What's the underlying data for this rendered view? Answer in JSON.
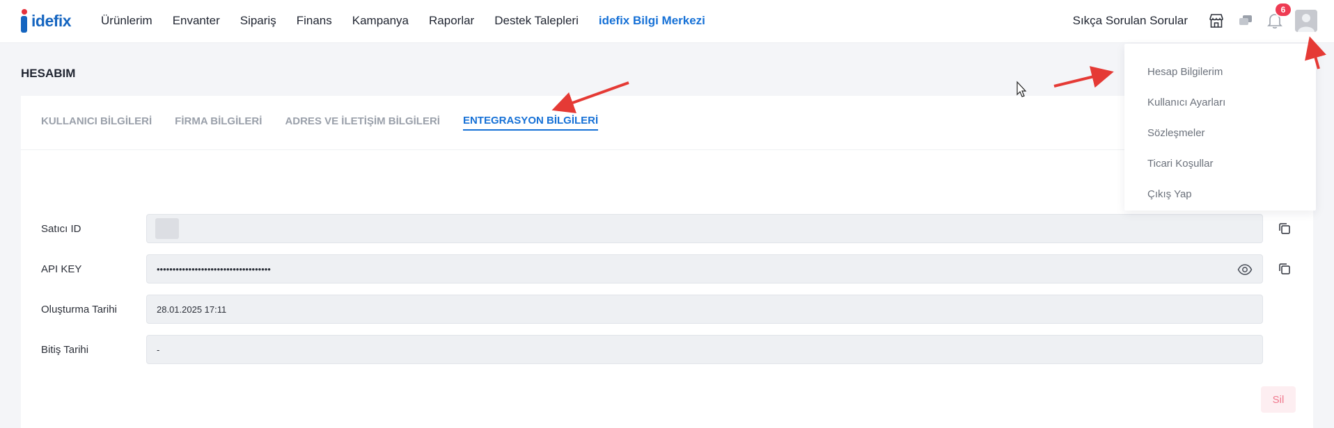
{
  "brand": {
    "logo_text": "idefix"
  },
  "nav": {
    "items": [
      "Ürünlerim",
      "Envanter",
      "Sipariş",
      "Finans",
      "Kampanya",
      "Raporlar",
      "Destek Talepleri"
    ],
    "highlight": "idefix Bilgi Merkezi"
  },
  "tools": {
    "faq": "Sıkça Sorulan Sorular",
    "notification_count": "6",
    "icons": [
      "store-icon",
      "chat-icon",
      "bell-icon",
      "user-avatar-icon"
    ]
  },
  "page": {
    "title": "HESABIM"
  },
  "tabs": {
    "items": [
      "KULLANICI BİLGİLERİ",
      "FİRMA BİLGİLERİ",
      "ADRES VE İLETİŞİM BİLGİLERİ",
      "ENTEGRASYON BİLGİLERİ"
    ],
    "active": "ENTEGRASYON BİLGİLERİ"
  },
  "fields": {
    "seller_id": {
      "label": "Satıcı ID",
      "value": ""
    },
    "api_key": {
      "label": "API KEY",
      "value": "••••••••••••••••••••••••••••••••••••"
    },
    "created": {
      "label": "Oluşturma Tarihi",
      "value": "28.01.2025 17:11"
    },
    "expires": {
      "label": "Bitiş Tarihi",
      "value": "-"
    }
  },
  "actions": {
    "delete_label": "Sil"
  },
  "dropdown": {
    "items": [
      "Hesap Bilgilerim",
      "Kullanıcı Ayarları",
      "Sözleşmeler",
      "Ticari Koşullar",
      "Çıkış Yap"
    ]
  },
  "colors": {
    "brand_blue": "#1565c0",
    "brand_red": "#e4313c",
    "active_tab": "#1570d6",
    "badge": "#ee3b53",
    "annotation_arrow": "#e53a35"
  }
}
